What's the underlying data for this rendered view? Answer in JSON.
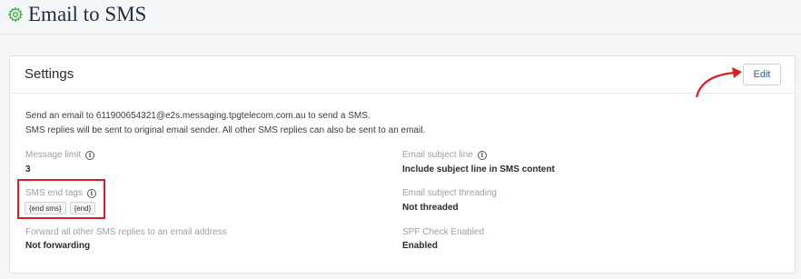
{
  "header": {
    "title": "Email to SMS",
    "icon": "gear-icon"
  },
  "settings": {
    "title": "Settings",
    "edit_label": "Edit",
    "description_line1": "Send an email to 611900654321@e2s.messaging.tpgtelecom.com.au to send a SMS.",
    "description_line2": "SMS replies will be sent to original email sender. All other SMS replies can also be sent to an email.",
    "fields": {
      "message_limit": {
        "label": "Message limit",
        "value": "3"
      },
      "email_subject_line": {
        "label": "Email subject line",
        "value": "Include subject line in SMS content"
      },
      "sms_end_tags": {
        "label": "SMS end tags",
        "tags": [
          "{end sms}",
          "{end}"
        ]
      },
      "email_subject_threading": {
        "label": "Email subject threading",
        "value": "Not threaded"
      },
      "forward_sms_replies": {
        "label": "Forward all other SMS replies to an email address",
        "value": "Not forwarding"
      },
      "spf_check": {
        "label": "SPF Check Enabled",
        "value": "Enabled"
      }
    }
  },
  "colors": {
    "accent_green": "#4caf50",
    "annotation_red": "#d81f26",
    "link_blue": "#2a5d8f"
  }
}
